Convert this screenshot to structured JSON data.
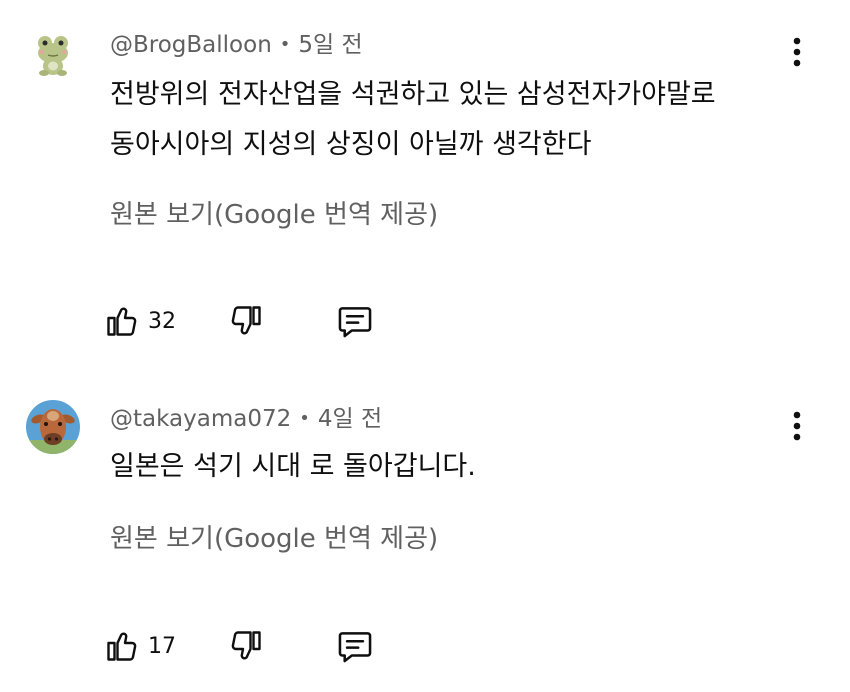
{
  "comments": [
    {
      "author": "@BrogBalloon",
      "time": "5일 전",
      "lines": [
        "전방위의 전자산업을 석권하고 있는 삼성전자가야말로",
        "동아시아의 지성의 상징이 아닐까 생각한다"
      ],
      "translate_label": "원본 보기(Google 번역 제공)",
      "likes": "32",
      "avatar_icon": "frog-avatar"
    },
    {
      "author": "@takayama072",
      "time": "4일 전",
      "lines": [
        "일본은 석기 시대 로 돌아갑니다."
      ],
      "translate_label": "원본 보기(Google 번역 제공)",
      "likes": "17",
      "avatar_icon": "cow-avatar"
    }
  ],
  "meta_separator": "•",
  "icons": {
    "like": "thumbs-up-icon",
    "dislike": "thumbs-down-icon",
    "reply": "reply-comment-icon",
    "menu": "more-vertical-icon"
  },
  "colors": {
    "primary_text": "#0f0f0f",
    "secondary_text": "#606060",
    "background": "#ffffff"
  }
}
